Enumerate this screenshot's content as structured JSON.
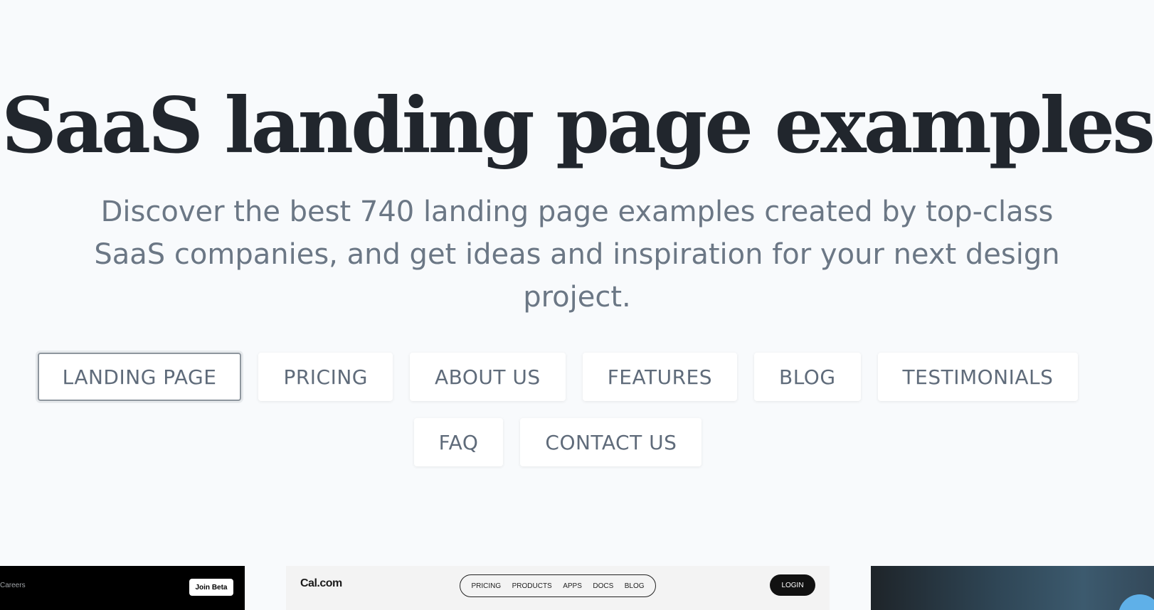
{
  "hero": {
    "title": "SaaS landing page examples",
    "subtitle": "Discover the best 740 landing page examples created by top-class SaaS companies, and get ideas and inspiration for your next design project."
  },
  "filters": {
    "row1": [
      "LANDING PAGE",
      "PRICING",
      "ABOUT US",
      "FEATURES",
      "BLOG",
      "TESTIMONIALS"
    ],
    "row2": [
      "FAQ",
      "CONTACT US"
    ],
    "active": "LANDING PAGE"
  },
  "thumbnails": {
    "left": {
      "nav_text": "Careers",
      "cta": "Join Beta"
    },
    "middle": {
      "brand": "Cal.com",
      "nav": [
        "PRICING",
        "PRODUCTS",
        "APPS",
        "DOCS",
        "BLOG"
      ],
      "cta": "LOGIN"
    }
  },
  "colors": {
    "background": "#f8fafc",
    "title": "#21262d",
    "subtitle": "#6b7785",
    "filter_text": "#5f6b7a",
    "active_border": "#8e969e"
  }
}
